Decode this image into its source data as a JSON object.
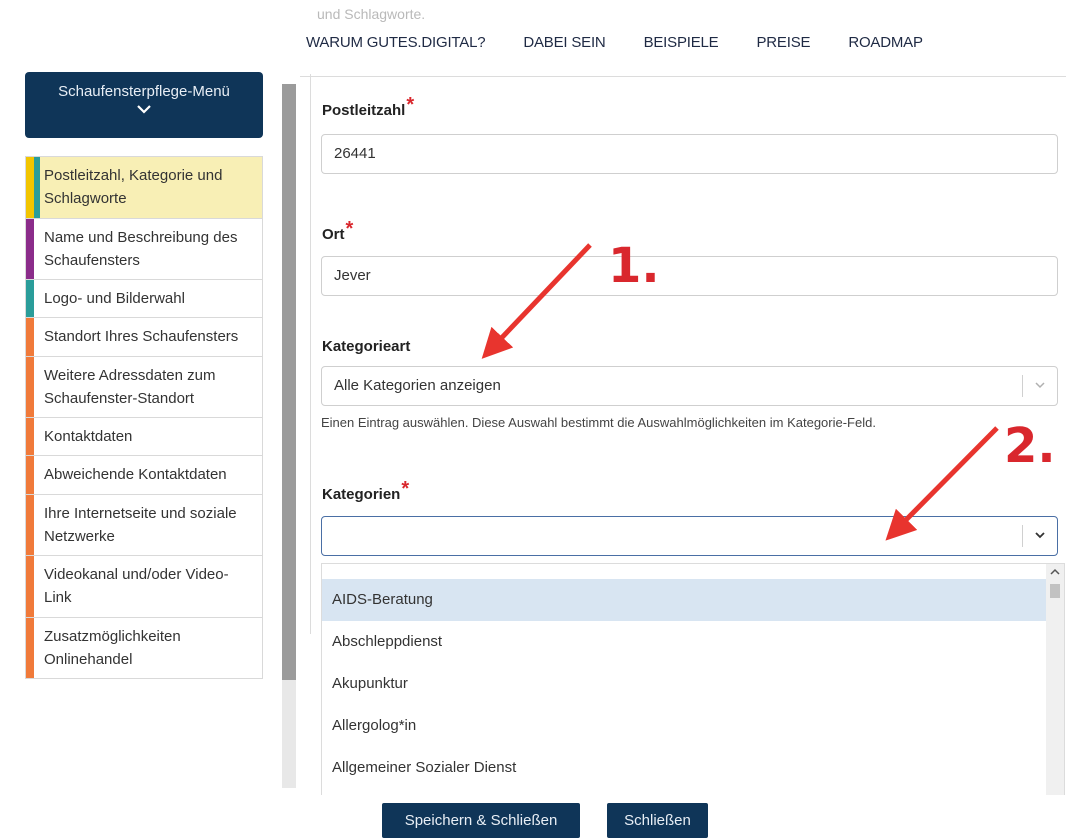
{
  "header": {
    "faded_text": "und Schlagworte.",
    "nav": [
      "WARUM GUTES.DIGITAL?",
      "DABEI SEIN",
      "BEISPIELE",
      "PREISE",
      "ROADMAP"
    ]
  },
  "sidebar": {
    "menu_button": "Schaufensterpflege-Menü",
    "items": [
      {
        "label": "Postleitzahl, Kategorie und Schlagworte",
        "color": "#2a9d9a",
        "active": true
      },
      {
        "label": "Name und Beschreibung des Schaufensters",
        "color": "#8b2c8a"
      },
      {
        "label": "Logo- und Bilderwahl",
        "color": "#2a9d9a"
      },
      {
        "label": "Standort Ihres Schaufensters",
        "color": "#f07a3a"
      },
      {
        "label": "Weitere Adressdaten zum Schaufenster-Standort",
        "color": "#f07a3a"
      },
      {
        "label": "Kontaktdaten",
        "color": "#f07a3a"
      },
      {
        "label": "Abweichende Kontaktdaten",
        "color": "#f07a3a"
      },
      {
        "label": "Ihre Internetseite und soziale Netzwerke",
        "color": "#f07a3a"
      },
      {
        "label": "Videokanal und/oder Video-Link",
        "color": "#f07a3a"
      },
      {
        "label": "Zusatzmöglichkeiten Onlinehandel",
        "color": "#f07a3a"
      }
    ]
  },
  "form": {
    "plz_label": "Postleitzahl",
    "plz_value": "26441",
    "ort_label": "Ort",
    "ort_value": "Jever",
    "kategorieart_label": "Kategorieart",
    "kategorieart_value": "Alle Kategorien anzeigen",
    "kategorieart_help": "Einen Eintrag auswählen. Diese Auswahl bestimmt die Auswahlmöglichkeiten im Kategorie-Feld.",
    "kategorien_label": "Kategorien",
    "kategorien_value": "",
    "required_mark": "*"
  },
  "dropdown": {
    "options": [
      "AIDS-Beratung",
      "Abschleppdienst",
      "Akupunktur",
      "Allergolog*in",
      "Allgemeiner Sozialer Dienst"
    ],
    "highlighted_index": 0
  },
  "footer": {
    "save_close": "Speichern & Schließen",
    "close": "Schließen"
  },
  "annotations": {
    "step1": "1.",
    "step2": "2.",
    "arrow_color": "#e8342e"
  }
}
